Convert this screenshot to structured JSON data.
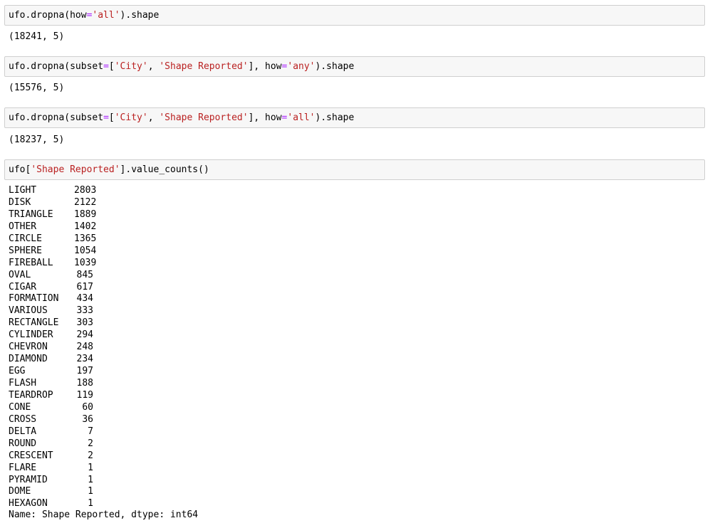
{
  "cells": [
    {
      "input": [
        {
          "t": "ufo.dropna(how"
        },
        {
          "t": "=",
          "k": "op"
        },
        {
          "t": "'all'",
          "k": "str"
        },
        {
          "t": ").shape"
        }
      ],
      "output": "(18241, 5)"
    },
    {
      "input": [
        {
          "t": "ufo.dropna(subset"
        },
        {
          "t": "=",
          "k": "op"
        },
        {
          "t": "["
        },
        {
          "t": "'City'",
          "k": "str"
        },
        {
          "t": ", "
        },
        {
          "t": "'Shape Reported'",
          "k": "str"
        },
        {
          "t": "], how"
        },
        {
          "t": "=",
          "k": "op"
        },
        {
          "t": "'any'",
          "k": "str"
        },
        {
          "t": ").shape"
        }
      ],
      "output": "(15576, 5)"
    },
    {
      "input": [
        {
          "t": "ufo.dropna(subset"
        },
        {
          "t": "=",
          "k": "op"
        },
        {
          "t": "["
        },
        {
          "t": "'City'",
          "k": "str"
        },
        {
          "t": ", "
        },
        {
          "t": "'Shape Reported'",
          "k": "str"
        },
        {
          "t": "], how"
        },
        {
          "t": "=",
          "k": "op"
        },
        {
          "t": "'all'",
          "k": "str"
        },
        {
          "t": ").shape"
        }
      ],
      "output": "(18237, 5)"
    },
    {
      "input": [
        {
          "t": "ufo["
        },
        {
          "t": "'Shape Reported'",
          "k": "str"
        },
        {
          "t": "].value_counts()"
        }
      ]
    }
  ],
  "value_counts": [
    {
      "label": "LIGHT",
      "value": "2803"
    },
    {
      "label": "DISK",
      "value": "2122"
    },
    {
      "label": "TRIANGLE",
      "value": "1889"
    },
    {
      "label": "OTHER",
      "value": "1402"
    },
    {
      "label": "CIRCLE",
      "value": "1365"
    },
    {
      "label": "SPHERE",
      "value": "1054"
    },
    {
      "label": "FIREBALL",
      "value": "1039"
    },
    {
      "label": "OVAL",
      "value": "845"
    },
    {
      "label": "CIGAR",
      "value": "617"
    },
    {
      "label": "FORMATION",
      "value": "434"
    },
    {
      "label": "VARIOUS",
      "value": "333"
    },
    {
      "label": "RECTANGLE",
      "value": "303"
    },
    {
      "label": "CYLINDER",
      "value": "294"
    },
    {
      "label": "CHEVRON",
      "value": "248"
    },
    {
      "label": "DIAMOND",
      "value": "234"
    },
    {
      "label": "EGG",
      "value": "197"
    },
    {
      "label": "FLASH",
      "value": "188"
    },
    {
      "label": "TEARDROP",
      "value": "119"
    },
    {
      "label": "CONE",
      "value": "60"
    },
    {
      "label": "CROSS",
      "value": "36"
    },
    {
      "label": "DELTA",
      "value": "7"
    },
    {
      "label": "ROUND",
      "value": "2"
    },
    {
      "label": "CRESCENT",
      "value": "2"
    },
    {
      "label": "FLARE",
      "value": "1"
    },
    {
      "label": "PYRAMID",
      "value": "1"
    },
    {
      "label": "DOME",
      "value": "1"
    },
    {
      "label": "HEXAGON",
      "value": "1"
    }
  ],
  "series_footer": "Name: Shape Reported, dtype: int64",
  "colors": {
    "string": "#ba2121",
    "operator": "#aa22ff",
    "input_bg": "#f7f7f7",
    "input_border": "#cfcfcf"
  }
}
